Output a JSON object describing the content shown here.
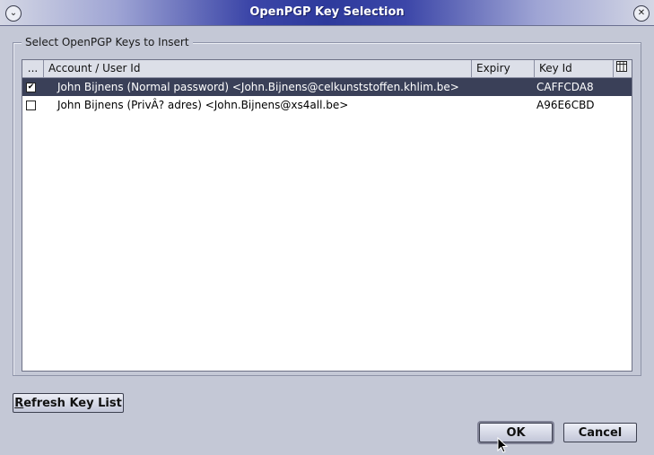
{
  "window": {
    "title": "OpenPGP Key Selection"
  },
  "group": {
    "label": "Select OpenPGP Keys to Insert"
  },
  "table": {
    "columns": {
      "select": "...",
      "account": "Account / User Id",
      "expiry": "Expiry",
      "keyid": "Key Id"
    },
    "rows": [
      {
        "checked": true,
        "check_mark": "✔",
        "user": "John Bijnens (Normal password) <John.Bijnens@celkunststoffen.khlim.be>",
        "expiry": "",
        "keyid": "CAFFCDA8"
      },
      {
        "checked": false,
        "check_mark": "",
        "user": "John Bijnens (PrivÂ? adres) <John.Bijnens@xs4all.be>",
        "expiry": "",
        "keyid": "A96E6CBD"
      }
    ]
  },
  "buttons": {
    "refresh": "Refresh Key List",
    "ok": "OK",
    "cancel": "Cancel"
  },
  "icons": {
    "window_menu": "chevron-down-icon",
    "close": "close-icon",
    "column_picker": "column-picker-icon"
  }
}
